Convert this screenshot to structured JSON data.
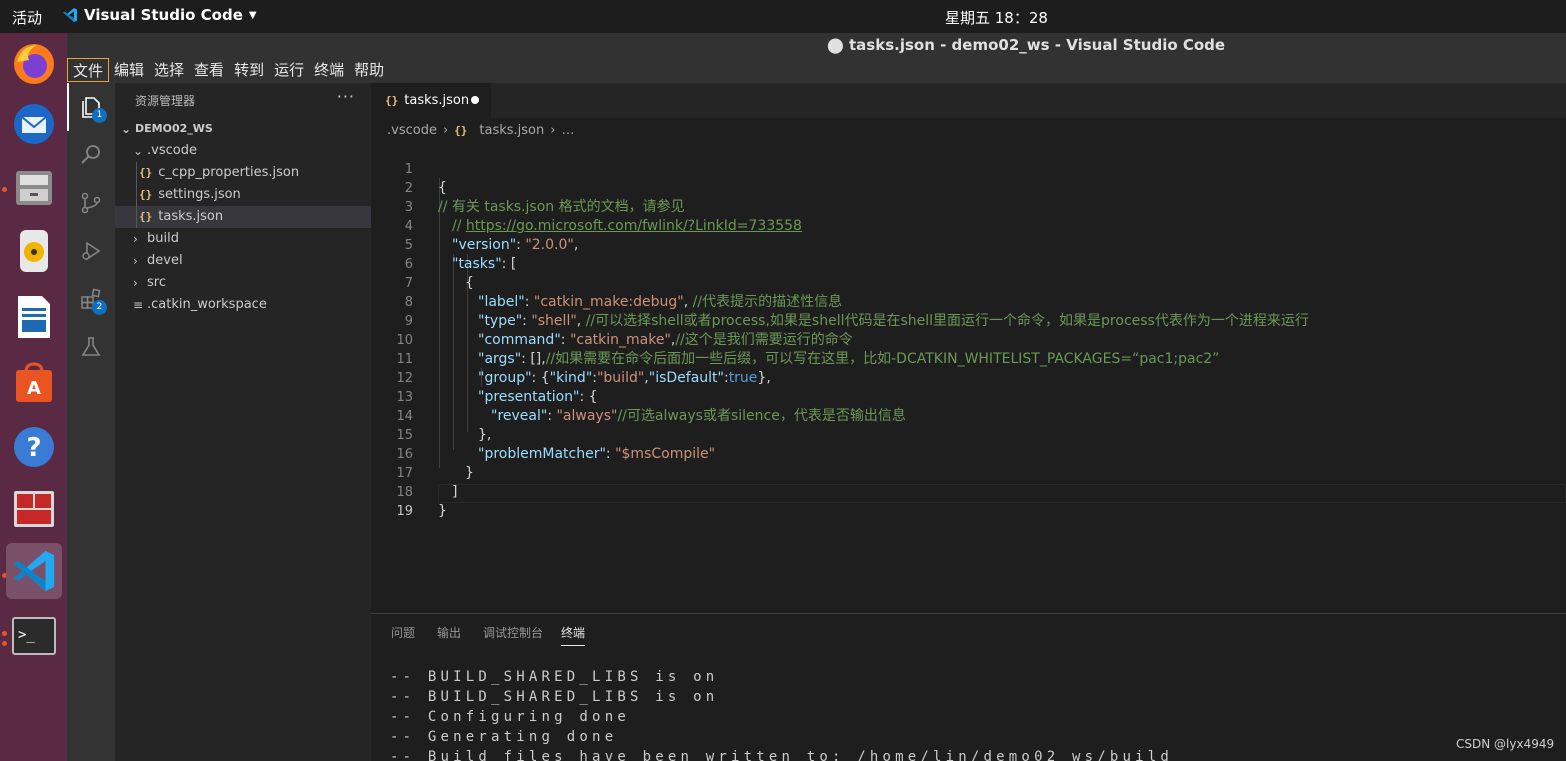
{
  "topbar": {
    "activities": "活动",
    "app_name": "Visual Studio Code",
    "clock": "星期五 18：28"
  },
  "window": {
    "title": "⬤ tasks.json - demo02_ws - Visual Studio Code"
  },
  "menu": [
    "文件",
    "编辑",
    "选择",
    "查看",
    "转到",
    "运行",
    "终端",
    "帮助"
  ],
  "activity_badges": {
    "explorer": "1",
    "extensions": "2"
  },
  "sidebar": {
    "title": "资源管理器",
    "more": "···",
    "root": "DEMO02_WS",
    "folder_vscode": ".vscode",
    "files": [
      "c_cpp_properties.json",
      "settings.json",
      "tasks.json"
    ],
    "folders": [
      "build",
      "devel",
      "src"
    ],
    "workspace_file": ".catkin_workspace"
  },
  "editor": {
    "tab_label": "tasks.json",
    "breadcrumb": {
      "folder": ".vscode",
      "file": "tasks.json",
      "more": "…"
    },
    "line_numbers": [
      "1",
      "2",
      "3",
      "4",
      "5",
      "6",
      "7",
      "8",
      "9",
      "10",
      "11",
      "12",
      "13",
      "14",
      "15",
      "16",
      "17",
      "18",
      "19"
    ],
    "current_line": 19,
    "lines": [
      [
        "{"
      ],
      [
        "// 有关 tasks.json 格式的文档，请参见"
      ],
      [
        "// ",
        "https://go.microsoft.com/fwlink/?LinkId=733558"
      ],
      [
        "\"version\"",
        ": ",
        "\"2.0.0\"",
        ","
      ],
      [
        "\"tasks\"",
        ": ["
      ],
      [
        "{"
      ],
      [
        "\"label\"",
        ": ",
        "\"catkin_make:debug\"",
        ", ",
        "//代表提示的描述性信息"
      ],
      [
        "\"type\"",
        ": ",
        "\"shell\"",
        ", ",
        "//可以选择shell或者process,如果是shell代码是在shell里面运行一个命令，如果是process代表作为一个进程来运行"
      ],
      [
        "\"command\"",
        ": ",
        "\"catkin_make\"",
        ",",
        "//这个是我们需要运行的命令"
      ],
      [
        "\"args\"",
        ": [],",
        "//如果需要在命令后面加一些后缀，可以写在这里，比如-DCATKIN_WHITELIST_PACKAGES=“pac1;pac2”"
      ],
      [
        "\"group\"",
        ": {",
        "\"kind\"",
        ":",
        "\"build\"",
        ",",
        "\"isDefault\"",
        ":",
        "true",
        "},"
      ],
      [
        "\"presentation\"",
        ": {"
      ],
      [
        "\"reveal\"",
        ": ",
        "\"always\"",
        "//可选always或者silence，代表是否输出信息"
      ],
      [
        "},"
      ],
      [
        "\"problemMatcher\"",
        ": ",
        "\"$msCompile\""
      ],
      [
        "}"
      ],
      [
        "]"
      ],
      [
        "}"
      ],
      [
        ""
      ]
    ]
  },
  "panel": {
    "tabs": [
      "问题",
      "输出",
      "调试控制台",
      "终端"
    ],
    "active_tab": "终端",
    "terminal_lines": [
      "-- BUILD_SHARED_LIBS is on",
      "-- BUILD_SHARED_LIBS is on",
      "-- Configuring done",
      "-- Generating done",
      "-- Build files have been written to: /home/lin/demo02_ws/build"
    ]
  },
  "watermark": "CSDN @lyx4949",
  "colors": {
    "accent": "#0e70c0",
    "dock": "#5a2a45",
    "string": "#ce9178",
    "key": "#9cdcfe",
    "comment": "#6a9955"
  }
}
